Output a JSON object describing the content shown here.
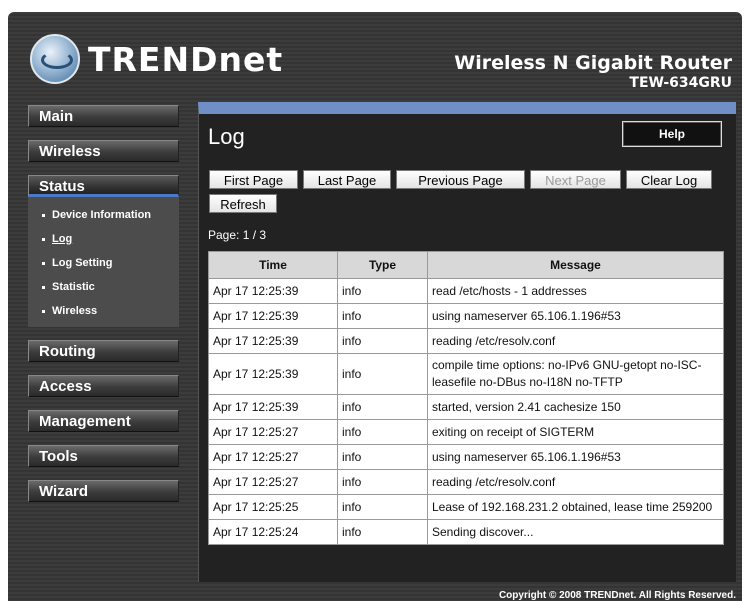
{
  "brand": {
    "logo_text": "TRENDnet",
    "product_name": "Wireless N Gigabit Router",
    "model": "TEW-634GRU"
  },
  "nav": {
    "items": [
      {
        "label": "Main"
      },
      {
        "label": "Wireless"
      },
      {
        "label": "Status"
      },
      {
        "label": "Routing"
      },
      {
        "label": "Access"
      },
      {
        "label": "Management"
      },
      {
        "label": "Tools"
      },
      {
        "label": "Wizard"
      }
    ],
    "status_sub": [
      {
        "label": "Device Information"
      },
      {
        "label": "Log"
      },
      {
        "label": "Log Setting"
      },
      {
        "label": "Statistic"
      },
      {
        "label": "Wireless"
      }
    ]
  },
  "panel": {
    "title": "Log",
    "help_label": "Help",
    "buttons": {
      "first_page": "First Page",
      "last_page": "Last Page",
      "previous_page": "Previous Page",
      "next_page": "Next Page",
      "clear_log": "Clear Log",
      "refresh": "Refresh"
    },
    "page_info": "Page: 1 / 3",
    "table": {
      "headers": [
        "Time",
        "Type",
        "Message"
      ],
      "rows": [
        [
          "Apr 17 12:25:39",
          "info",
          "read /etc/hosts - 1 addresses"
        ],
        [
          "Apr 17 12:25:39",
          "info",
          "using nameserver 65.106.1.196#53"
        ],
        [
          "Apr 17 12:25:39",
          "info",
          "reading /etc/resolv.conf"
        ],
        [
          "Apr 17 12:25:39",
          "info",
          "compile time options: no-IPv6 GNU-getopt no-ISC-leasefile no-DBus no-I18N no-TFTP"
        ],
        [
          "Apr 17 12:25:39",
          "info",
          "started, version 2.41 cachesize 150"
        ],
        [
          "Apr 17 12:25:27",
          "info",
          "exiting on receipt of SIGTERM"
        ],
        [
          "Apr 17 12:25:27",
          "info",
          "using nameserver 65.106.1.196#53"
        ],
        [
          "Apr 17 12:25:27",
          "info",
          "reading /etc/resolv.conf"
        ],
        [
          "Apr 17 12:25:25",
          "info",
          "Lease of 192.168.231.2 obtained, lease time 259200"
        ],
        [
          "Apr 17 12:25:24",
          "info",
          "Sending discover..."
        ]
      ]
    }
  },
  "footer": {
    "copyright": "Copyright © 2008 TRENDnet. All Rights Reserved."
  },
  "colors": {
    "accent": "#6f8fc6",
    "panel_bg": "#222222",
    "frame_bg": "#3a3a3a"
  }
}
